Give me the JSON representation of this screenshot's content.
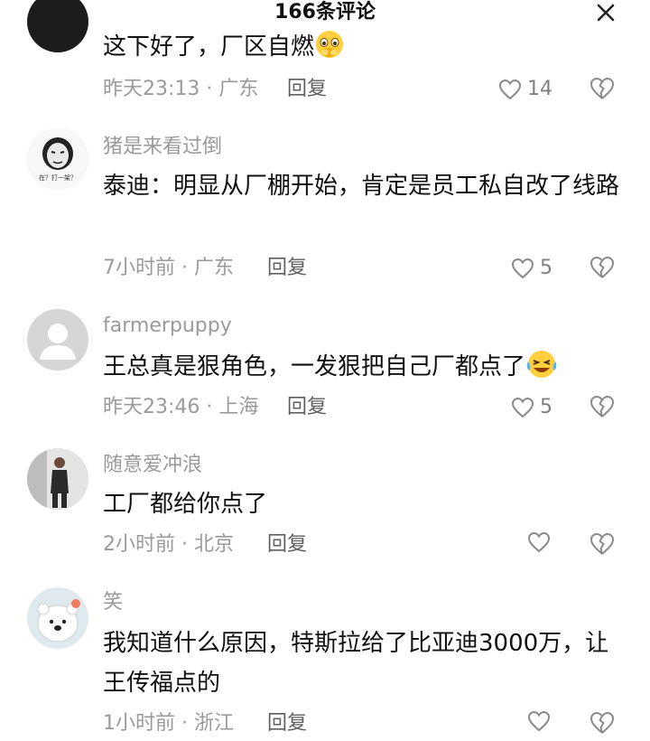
{
  "header": {
    "title": "166条评论"
  },
  "comments": [
    {
      "username": "",
      "content": "这下好了，厂区自燃",
      "time": "昨天23:13",
      "location": "广东",
      "reply": "回复",
      "likes": "14"
    },
    {
      "username": "猪是来看过倒",
      "content": "泰迪：明显从厂棚开始，肯定是员工私自改了线路",
      "time": "7小时前",
      "location": "广东",
      "reply": "回复",
      "likes": "5",
      "avatar_text": "在？打一架？"
    },
    {
      "username": "farmerpuppy",
      "content": "王总真是狠角色，一发狠把自己厂都点了",
      "time": "昨天23:46",
      "location": "上海",
      "reply": "回复",
      "likes": "5"
    },
    {
      "username": "随意爱冲浪",
      "content": "工厂都给你点了",
      "time": "2小时前",
      "location": "北京",
      "reply": "回复",
      "likes": ""
    },
    {
      "username": "笑",
      "content": "我知道什么原因，特斯拉给了比亚迪3000万，让王传福点的",
      "time": "1小时前",
      "location": "浙江",
      "reply": "回复",
      "likes": ""
    }
  ],
  "meta_separator": " · ",
  "icons": {
    "close": "close-icon",
    "like": "heart-icon",
    "dislike": "broken-heart-icon",
    "emoji_1": "shy-face-emoji",
    "emoji_2": "laughing-tears-emoji"
  },
  "colors": {
    "text": "#111111",
    "secondary": "#9a9a9a",
    "reply": "#606060",
    "icon": "#8a8a8a"
  }
}
